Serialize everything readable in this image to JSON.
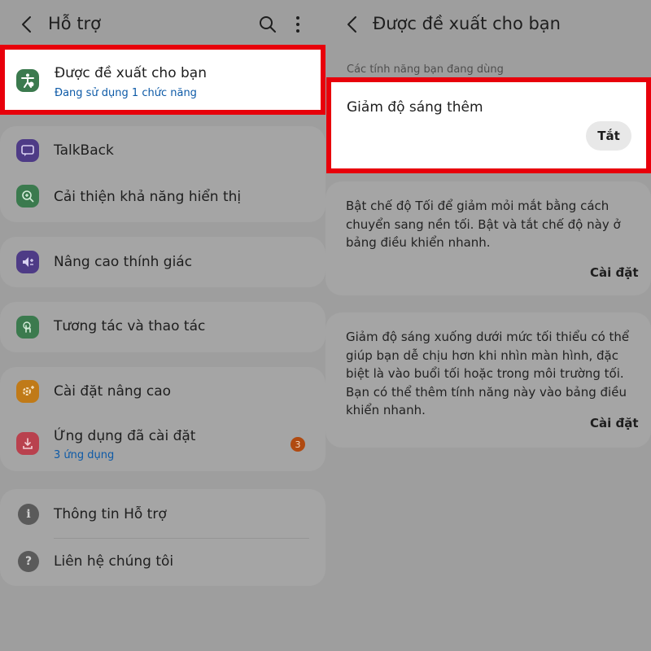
{
  "left": {
    "header": {
      "title": "Hỗ trợ"
    },
    "recommended": {
      "title": "Được đề xuất cho bạn",
      "subtitle": "Đang sử dụng 1 chức năng"
    },
    "items": [
      {
        "label": "TalkBack"
      },
      {
        "label": "Cải thiện khả năng hiển thị"
      },
      {
        "label": "Nâng cao thính giác"
      },
      {
        "label": "Tương tác và thao tác"
      },
      {
        "label": "Cài đặt nâng cao"
      },
      {
        "label": "Ứng dụng đã cài đặt",
        "subtitle": "3 ứng dụng",
        "badge": "3"
      },
      {
        "label": "Thông tin Hỗ trợ"
      },
      {
        "label": "Liên hệ chúng tôi"
      }
    ]
  },
  "right": {
    "header": {
      "title": "Được đề xuất cho bạn"
    },
    "section_label": "Các tính năng bạn đang dùng",
    "active_feature": {
      "title": "Giảm độ sáng thêm",
      "button": "Tắt"
    },
    "cards": [
      {
        "text": "Bật chế độ Tối để giảm mỏi mắt bằng cách chuyển sang nền tối. Bật và tắt chế độ này ở bảng điều khiển nhanh.",
        "action": "Cài đặt"
      },
      {
        "text": "Giảm độ sáng xuống dưới mức tối thiểu có thể giúp bạn dễ chịu hơn khi nhìn màn hình, đặc biệt là vào buổi tối hoặc trong môi trường tối. Bạn có thể thêm tính năng này vào bảng điều khiển nhanh.",
        "action": "Cài đặt"
      }
    ]
  },
  "colors": {
    "highlight": "#e8000b",
    "link": "#0d5aa7",
    "icon_green": "#3b7a4e",
    "icon_purple": "#4e3b86",
    "icon_orange": "#c07a18",
    "icon_red": "#b9414e",
    "icon_grey": "#5a5a5a"
  }
}
